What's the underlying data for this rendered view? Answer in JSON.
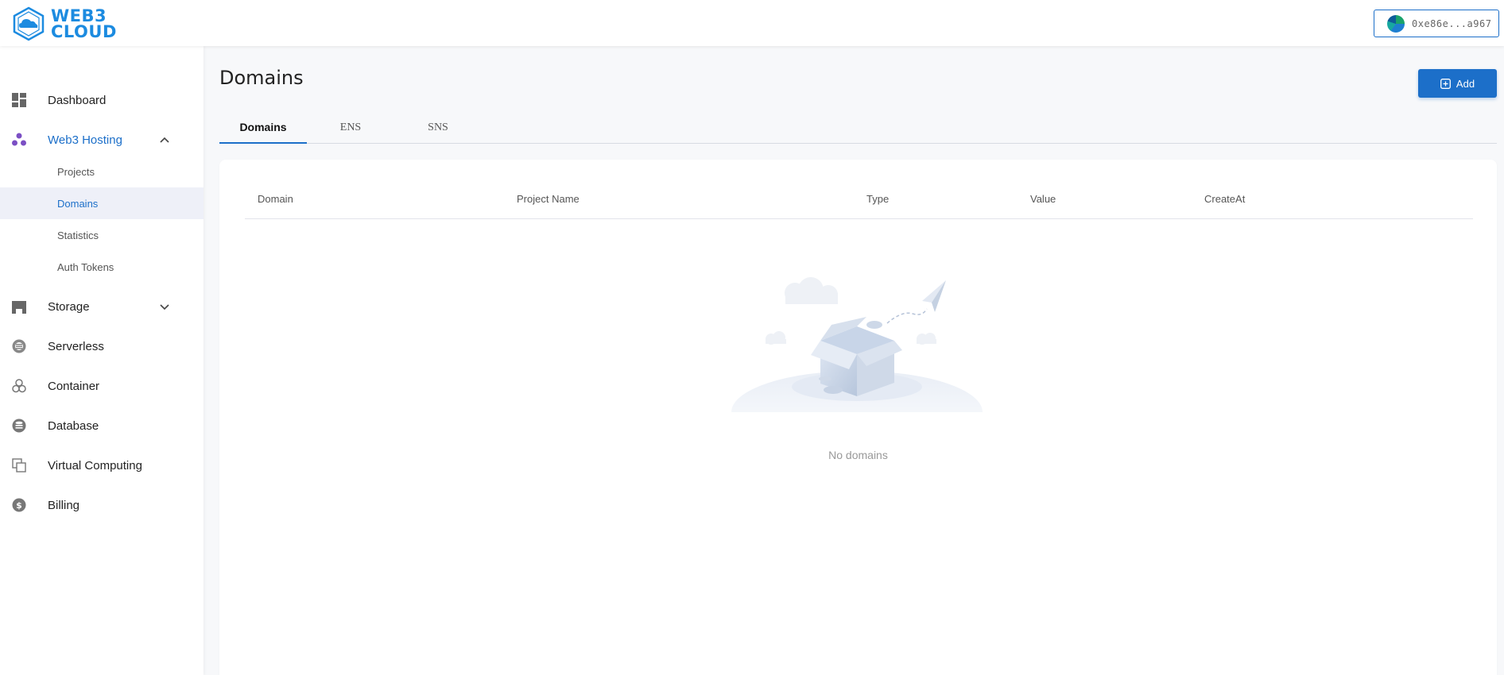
{
  "brand": {
    "line1": "WEB3",
    "line2": "CLOUD"
  },
  "wallet": {
    "address": "0xe86e...a967"
  },
  "sidebar": {
    "items": [
      {
        "label": "Dashboard",
        "icon": "dashboard-icon"
      },
      {
        "label": "Web3 Hosting",
        "icon": "hosting-icon",
        "expanded": true
      },
      {
        "label": "Storage",
        "icon": "storage-icon",
        "expanded": false
      },
      {
        "label": "Serverless",
        "icon": "serverless-icon"
      },
      {
        "label": "Container",
        "icon": "container-icon"
      },
      {
        "label": "Database",
        "icon": "database-icon"
      },
      {
        "label": "Virtual Computing",
        "icon": "virtual-computing-icon"
      },
      {
        "label": "Billing",
        "icon": "billing-icon"
      }
    ],
    "hosting_subitems": [
      {
        "label": "Projects"
      },
      {
        "label": "Domains",
        "active": true
      },
      {
        "label": "Statistics"
      },
      {
        "label": "Auth Tokens"
      }
    ]
  },
  "main": {
    "title": "Domains",
    "add_label": "Add",
    "tabs": [
      {
        "label": "Domains",
        "active": true
      },
      {
        "label": "ENS"
      },
      {
        "label": "SNS"
      }
    ],
    "table": {
      "columns": [
        "Domain",
        "Project Name",
        "Type",
        "Value",
        "CreateAt"
      ],
      "rows": []
    },
    "empty_text": "No domains"
  },
  "colors": {
    "accent": "#1c6fc9",
    "hosting_icon": "#7b4fc4",
    "background": "#f7f8fa"
  }
}
